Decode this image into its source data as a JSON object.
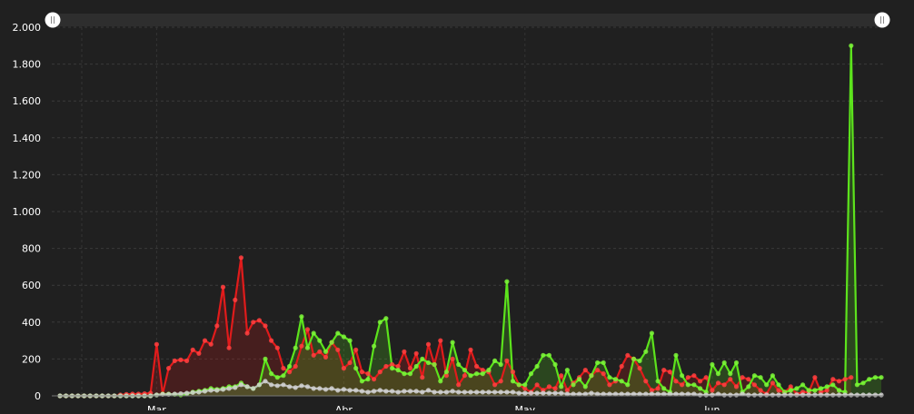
{
  "chart_data": {
    "type": "line",
    "title": "",
    "xlabel": "",
    "ylabel": "",
    "ylim": [
      0,
      2000
    ],
    "y_ticks": [
      0,
      200,
      400,
      600,
      800,
      1000,
      1200,
      1400,
      1600,
      1800,
      2000
    ],
    "y_tick_labels": [
      "0",
      "200",
      "400",
      "600",
      "800",
      "1.000",
      "1.200",
      "1.400",
      "1.600",
      "1.800",
      "2.000"
    ],
    "x_range": [
      "2020-02-14",
      "2020-06-29"
    ],
    "x_ticks": [
      "2020-03-01",
      "2020-04-01",
      "2020-05-01",
      "2020-06-01"
    ],
    "x_tick_labels": [
      "Mar",
      "Abr",
      "May",
      "Jun"
    ],
    "grid": true,
    "navigator_handles": true,
    "x": [
      "2020-02-14",
      "2020-02-15",
      "2020-02-16",
      "2020-02-17",
      "2020-02-18",
      "2020-02-19",
      "2020-02-20",
      "2020-02-21",
      "2020-02-22",
      "2020-02-23",
      "2020-02-24",
      "2020-02-25",
      "2020-02-26",
      "2020-02-27",
      "2020-02-28",
      "2020-02-29",
      "2020-03-01",
      "2020-03-02",
      "2020-03-03",
      "2020-03-04",
      "2020-03-05",
      "2020-03-06",
      "2020-03-07",
      "2020-03-08",
      "2020-03-09",
      "2020-03-10",
      "2020-03-11",
      "2020-03-12",
      "2020-03-13",
      "2020-03-14",
      "2020-03-15",
      "2020-03-16",
      "2020-03-17",
      "2020-03-18",
      "2020-03-19",
      "2020-03-20",
      "2020-03-21",
      "2020-03-22",
      "2020-03-23",
      "2020-03-24",
      "2020-03-25",
      "2020-03-26",
      "2020-03-27",
      "2020-03-28",
      "2020-03-29",
      "2020-03-30",
      "2020-03-31",
      "2020-04-01",
      "2020-04-02",
      "2020-04-03",
      "2020-04-04",
      "2020-04-05",
      "2020-04-06",
      "2020-04-07",
      "2020-04-08",
      "2020-04-09",
      "2020-04-10",
      "2020-04-11",
      "2020-04-12",
      "2020-04-13",
      "2020-04-14",
      "2020-04-15",
      "2020-04-16",
      "2020-04-17",
      "2020-04-18",
      "2020-04-19",
      "2020-04-20",
      "2020-04-21",
      "2020-04-22",
      "2020-04-23",
      "2020-04-24",
      "2020-04-25",
      "2020-04-26",
      "2020-04-27",
      "2020-04-28",
      "2020-04-29",
      "2020-04-30",
      "2020-05-01",
      "2020-05-02",
      "2020-05-03",
      "2020-05-04",
      "2020-05-05",
      "2020-05-06",
      "2020-05-07",
      "2020-05-08",
      "2020-05-09",
      "2020-05-10",
      "2020-05-11",
      "2020-05-12",
      "2020-05-13",
      "2020-05-14",
      "2020-05-15",
      "2020-05-16",
      "2020-05-17",
      "2020-05-18",
      "2020-05-19",
      "2020-05-20",
      "2020-05-21",
      "2020-05-22",
      "2020-05-23",
      "2020-05-24",
      "2020-05-25",
      "2020-05-26",
      "2020-05-27",
      "2020-05-28",
      "2020-05-29",
      "2020-05-30",
      "2020-05-31",
      "2020-06-01",
      "2020-06-02",
      "2020-06-03",
      "2020-06-04",
      "2020-06-05",
      "2020-06-06",
      "2020-06-07",
      "2020-06-08",
      "2020-06-09",
      "2020-06-10",
      "2020-06-11",
      "2020-06-12",
      "2020-06-13",
      "2020-06-14",
      "2020-06-15",
      "2020-06-16",
      "2020-06-17",
      "2020-06-18",
      "2020-06-19",
      "2020-06-20",
      "2020-06-21",
      "2020-06-22",
      "2020-06-23",
      "2020-06-24",
      "2020-06-25",
      "2020-06-26",
      "2020-06-27",
      "2020-06-28",
      "2020-06-29"
    ],
    "series": [
      {
        "color": "#e01b1b",
        "values": [
          0,
          0,
          0,
          0,
          0,
          0,
          0,
          0,
          0,
          0,
          5,
          8,
          10,
          10,
          12,
          15,
          280,
          10,
          150,
          190,
          195,
          190,
          250,
          230,
          300,
          280,
          380,
          590,
          260,
          520,
          750,
          340,
          400,
          410,
          380,
          300,
          260,
          150,
          130,
          160,
          270,
          360,
          220,
          240,
          210,
          290,
          250,
          150,
          180,
          250,
          130,
          120,
          90,
          130,
          160,
          170,
          160,
          240,
          150,
          230,
          100,
          280,
          170,
          300,
          110,
          200,
          60,
          110,
          250,
          160,
          140,
          130,
          60,
          80,
          190,
          130,
          60,
          40,
          20,
          60,
          30,
          50,
          40,
          110,
          30,
          70,
          100,
          140,
          110,
          140,
          120,
          60,
          80,
          160,
          220,
          200,
          150,
          80,
          30,
          40,
          140,
          130,
          80,
          60,
          100,
          110,
          80,
          100,
          30,
          70,
          60,
          90,
          50,
          100,
          90,
          60,
          30,
          10,
          70,
          30,
          20,
          50,
          10,
          20,
          20,
          100,
          20,
          30,
          90,
          80,
          90,
          100
        ],
        "point_color": "#ff4040"
      },
      {
        "color": "#5ce31c",
        "values": [
          0,
          0,
          0,
          0,
          0,
          0,
          0,
          0,
          0,
          0,
          0,
          0,
          0,
          0,
          0,
          0,
          5,
          10,
          10,
          8,
          5,
          10,
          20,
          25,
          30,
          40,
          35,
          40,
          50,
          50,
          70,
          50,
          40,
          60,
          200,
          120,
          100,
          110,
          160,
          260,
          430,
          260,
          340,
          300,
          240,
          290,
          340,
          320,
          300,
          150,
          80,
          90,
          270,
          400,
          420,
          150,
          140,
          120,
          120,
          160,
          200,
          180,
          170,
          80,
          130,
          290,
          170,
          140,
          110,
          120,
          120,
          140,
          190,
          170,
          620,
          80,
          60,
          60,
          120,
          160,
          220,
          220,
          170,
          50,
          140,
          60,
          90,
          50,
          110,
          180,
          180,
          100,
          90,
          80,
          60,
          200,
          190,
          240,
          340,
          80,
          40,
          20,
          220,
          110,
          60,
          60,
          40,
          20,
          170,
          120,
          180,
          120,
          180,
          20,
          50,
          110,
          100,
          60,
          110,
          60,
          20,
          30,
          40,
          60,
          30,
          30,
          40,
          50,
          60,
          30,
          20,
          1900,
          60,
          70,
          90,
          100,
          100
        ],
        "point_color": "#7cf53a"
      },
      {
        "color": "#b8b8b8",
        "values": [
          0,
          0,
          0,
          0,
          0,
          0,
          0,
          0,
          0,
          0,
          0,
          0,
          0,
          0,
          0,
          0,
          5,
          8,
          8,
          10,
          12,
          15,
          18,
          20,
          25,
          30,
          30,
          35,
          40,
          45,
          60,
          50,
          40,
          60,
          80,
          60,
          55,
          60,
          50,
          45,
          55,
          50,
          40,
          40,
          35,
          40,
          30,
          35,
          30,
          30,
          25,
          20,
          25,
          30,
          25,
          25,
          20,
          25,
          25,
          25,
          20,
          30,
          20,
          20,
          20,
          25,
          20,
          20,
          20,
          20,
          20,
          20,
          20,
          20,
          20,
          20,
          15,
          15,
          15,
          15,
          15,
          15,
          15,
          15,
          10,
          10,
          10,
          10,
          15,
          10,
          10,
          10,
          10,
          10,
          10,
          10,
          10,
          10,
          10,
          10,
          10,
          10,
          10,
          10,
          10,
          10,
          5,
          5,
          5,
          10,
          5,
          5,
          5,
          10,
          5,
          5,
          5,
          5,
          5,
          5,
          5,
          5,
          5,
          5,
          5,
          5,
          5,
          5,
          5,
          5,
          5,
          5,
          5,
          5,
          5,
          5,
          5
        ],
        "point_color": "#d0d0d0"
      }
    ]
  }
}
